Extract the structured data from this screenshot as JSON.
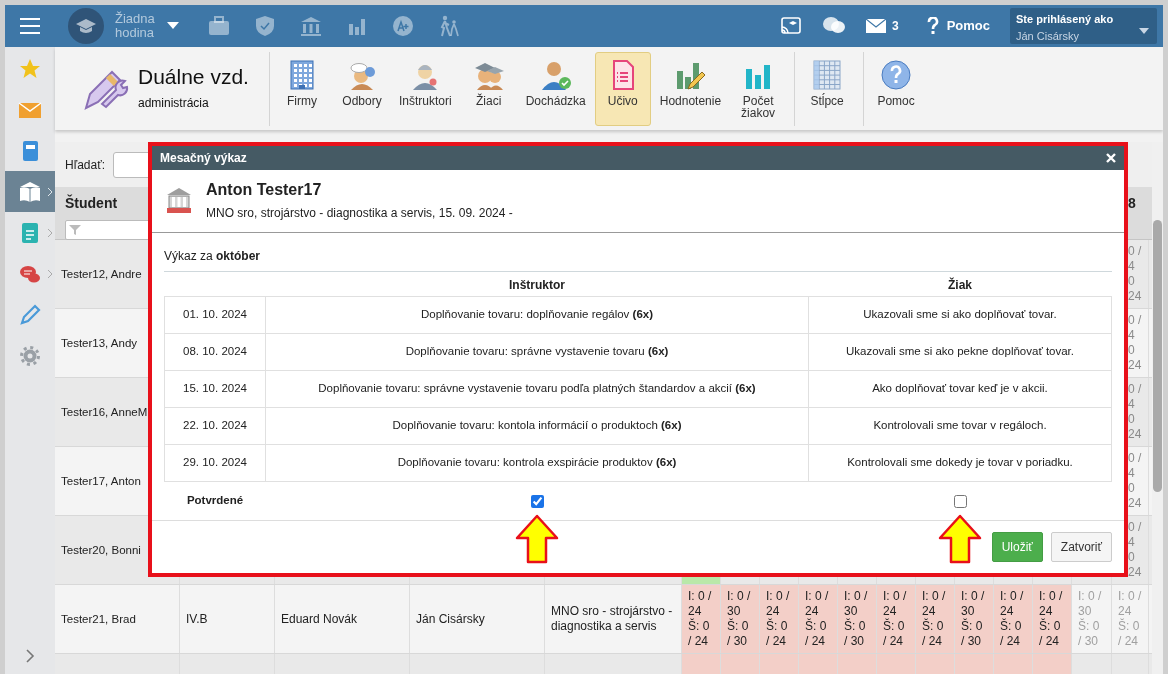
{
  "navbar": {
    "hour_label": "Žiadna hodina",
    "message_count": "3",
    "help_label": "Pomoc",
    "user_caption": "Ste prihlásený ako",
    "user_name": "Ján Cisársky"
  },
  "sidebar": {
    "items": [
      {
        "selected": false,
        "submenu": false
      },
      {
        "selected": false,
        "submenu": false
      },
      {
        "selected": false,
        "submenu": false
      },
      {
        "selected": true,
        "submenu": true
      },
      {
        "selected": false,
        "submenu": true
      },
      {
        "selected": false,
        "submenu": true
      },
      {
        "selected": false,
        "submenu": false
      },
      {
        "selected": false,
        "submenu": false
      }
    ]
  },
  "module": {
    "title": "Duálne vzd.",
    "subtitle": "administrácia"
  },
  "toolbar": {
    "groups": [
      [
        {
          "label": "Firmy",
          "selected": false
        },
        {
          "label": "Odbory",
          "selected": false
        },
        {
          "label": "Inštruktori",
          "selected": false
        },
        {
          "label": "Žiaci",
          "selected": false
        },
        {
          "label": "Dochádzka",
          "selected": false
        },
        {
          "label": "Učivo",
          "selected": true
        },
        {
          "label": "Hodnotenie",
          "selected": false
        },
        {
          "label": "Počet žiakov",
          "selected": false
        }
      ],
      [
        {
          "label": "Stĺpce",
          "selected": false
        }
      ],
      [
        {
          "label": "Pomoc",
          "selected": false
        }
      ]
    ]
  },
  "search": {
    "label": "Hľadať:"
  },
  "table": {
    "student_header": "Študent",
    "edge_header": "8",
    "rows": [
      {
        "student": "Tester12, Andre",
        "edge": [
          "0 /",
          "4",
          "0",
          "24"
        ]
      },
      {
        "student": "Tester13, Andy",
        "edge": [
          "0 /",
          "4",
          "0",
          "24"
        ]
      },
      {
        "student": "Tester16, AnneM",
        "edge": [
          "0 /",
          "4",
          "0",
          "24"
        ]
      },
      {
        "student": "Tester17, Anton",
        "edge": [
          "0 /",
          "4",
          "0",
          "24"
        ]
      },
      {
        "student": "Tester20, Bonni",
        "edge": [
          "0 /",
          "4",
          "0",
          "24"
        ],
        "periods": [
          {
            "kind": "met"
          }
        ]
      },
      {
        "student": "Tester21, Brad",
        "class_name": "IV.B",
        "instructor": "Eduard Novák",
        "teacher": "Ján Cisársky",
        "company": "MNO sro - strojárstvo - diagnostika a servis",
        "periods": [
          {
            "kind": "unmet",
            "text": "I: 0 / 24 Š: 0 / 24"
          },
          {
            "kind": "unmet",
            "text": "I: 0 / 30 Š: 0 / 30"
          },
          {
            "kind": "unmet",
            "text": "I: 0 / 24 Š: 0 / 24"
          },
          {
            "kind": "unmet",
            "text": "I: 0 / 24 Š: 0 / 24"
          },
          {
            "kind": "unmet",
            "text": "I: 0 / 30 Š: 0 / 30"
          },
          {
            "kind": "unmet",
            "text": "I: 0 / 24 Š: 0 / 24"
          },
          {
            "kind": "unmet",
            "text": "I: 0 / 24 Š: 0 / 24"
          },
          {
            "kind": "unmet",
            "text": "I: 0 / 30 Š: 0 / 30"
          },
          {
            "kind": "unmet",
            "text": "I: 0 / 24 Š: 0 / 24"
          },
          {
            "kind": "unmet",
            "text": "I: 0 / 24 Š: 0 / 24"
          },
          {
            "kind": "inactive",
            "text": "I: 0 / 30 Š: 0 / 30"
          },
          {
            "kind": "inactive",
            "text": "I: 0 / 24 Š: 0 / 24"
          }
        ]
      },
      {
        "periods": [
          {
            "kind": "unmet"
          },
          {
            "kind": "unmet"
          },
          {
            "kind": "unmet"
          },
          {
            "kind": "unmet"
          },
          {
            "kind": "unmet"
          },
          {
            "kind": "unmet"
          },
          {
            "kind": "unmet"
          },
          {
            "kind": "unmet"
          },
          {
            "kind": "unmet"
          },
          {
            "kind": "unmet"
          },
          {
            "kind": "inactive"
          },
          {
            "kind": "inactive"
          }
        ]
      }
    ]
  },
  "modal": {
    "title": "Mesačný výkaz",
    "student_name": "Anton Tester17",
    "subtitle": "MNO sro, strojárstvo - diagnostika a servis, 15. 09. 2024 -",
    "period_label": "Výkaz za **október**",
    "columns": [
      "Inštruktor",
      "Žiak"
    ],
    "entries": [
      {
        "date": "01. 10. 2024",
        "instructor": "Doplňovanie tovaru: doplňovanie regálov **(6x)**",
        "student": "Ukazovali sme si ako doplňovať tovar."
      },
      {
        "date": "08. 10. 2024",
        "instructor": "Doplňovanie tovaru: správne vystavenie tovaru **(6x)**",
        "student": "Ukazovali sme si ako pekne doplňovať tovar."
      },
      {
        "date": "15. 10. 2024",
        "instructor": "Doplňovanie tovaru: správne vystavenie tovaru podľa platných štandardov a akcií **(6x)**",
        "student": "Ako doplňovať tovar keď je v akcii."
      },
      {
        "date": "22. 10. 2024",
        "instructor": "Doplňovanie tovaru: kontola informácií o produktoch **(6x)**",
        "student": "Kontrolovali sme tovar v regáloch."
      },
      {
        "date": "29. 10. 2024",
        "instructor": "Doplňovanie tovaru: kontrola exspirácie produktov **(6x)**",
        "student": "Kontrolovali sme dokedy je tovar v poriadku."
      }
    ],
    "confirm_label": "Potvrdené",
    "confirmed_instructor": true,
    "confirmed_student": false,
    "buttons": [
      {
        "label": "Uložiť",
        "kind": "primary"
      },
      {
        "label": "Zatvoriť",
        "kind": "secondary"
      }
    ]
  }
}
